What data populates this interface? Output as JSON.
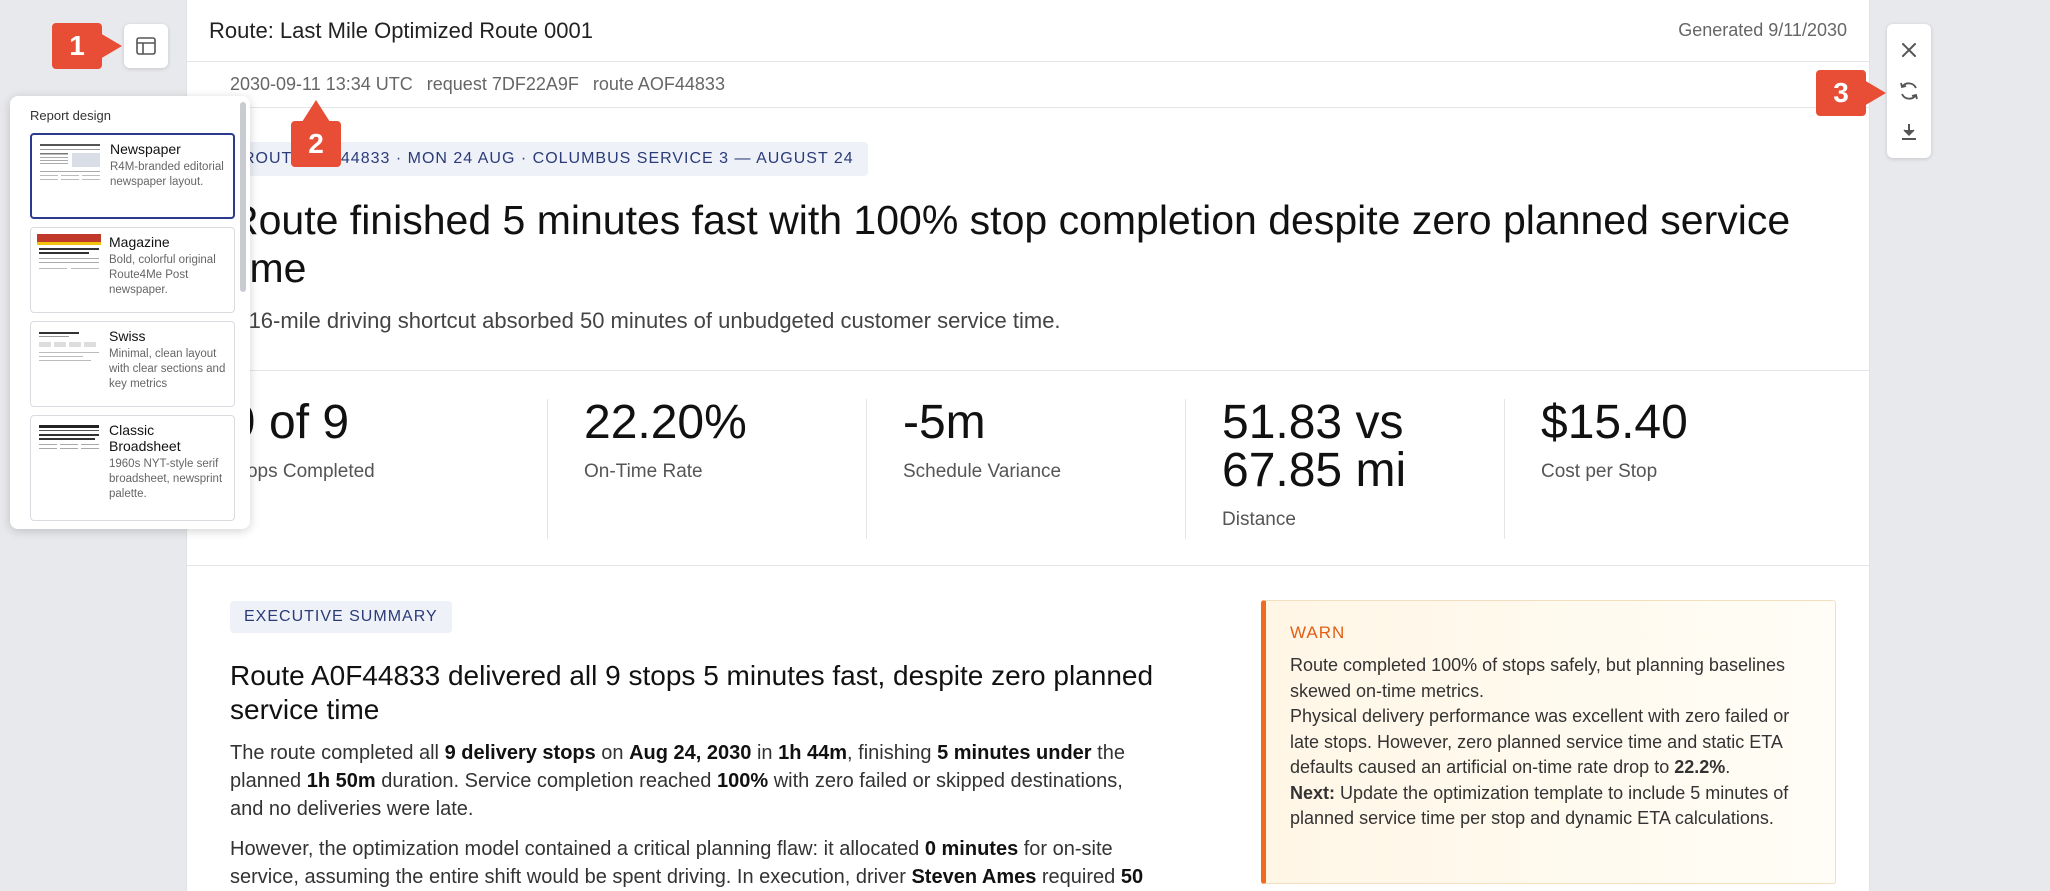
{
  "header": {
    "title": "Route: Last Mile Optimized Route 0001",
    "generated": "Generated 9/11/2030"
  },
  "meta": {
    "timestamp": "2030-09-11 13:34 UTC",
    "request": "request 7DF22A9F",
    "route": "route AOF44833"
  },
  "hero": {
    "tag": "ROUTE A0F44833 · MON 24 AUG · COLUMBUS SERVICE 3 — AUGUST 24",
    "headline": "Route finished 5 minutes fast with 100% stop completion despite zero planned service time",
    "subhead": "A 16-mile driving shortcut absorbed 50 minutes of unbudgeted customer service time."
  },
  "kpis": [
    {
      "value": "9 of 9",
      "label": "Stops Completed"
    },
    {
      "value": "22.20%",
      "label": "On-Time Rate"
    },
    {
      "value": "-5m",
      "label": "Schedule Variance"
    },
    {
      "value": "51.83 vs 67.85 mi",
      "label": "Distance"
    },
    {
      "value": "$15.40",
      "label": "Cost per Stop"
    }
  ],
  "summary": {
    "tag": "EXECUTIVE SUMMARY",
    "title": "Route A0F44833 delivered all 9 stops 5 minutes fast, despite zero planned service time",
    "p1": [
      "The route completed all ",
      "9 delivery stops",
      " on ",
      "Aug 24, 2030",
      " in ",
      "1h 44m",
      ", finishing ",
      "5 minutes under",
      " the planned ",
      "1h 50m",
      " duration. Service completion reached ",
      "100%",
      " with zero failed or skipped destinations, and no deliveries were late."
    ],
    "p2": [
      "However, the optimization model contained a critical planning flaw: it allocated ",
      "0 minutes",
      " for on-site service, assuming the entire shift would be spent driving. In execution, driver ",
      "Steven Ames",
      " required ",
      "50"
    ]
  },
  "warn": {
    "label": "WARN",
    "line1": "Route completed 100% of stops safely, but planning baselines skewed on-time metrics.",
    "line2": "Physical delivery performance was excellent with zero failed or late stops. However, zero planned service time and static ETA defaults caused an artificial on-time rate drop to ",
    "line2_bold": "22.2%",
    "line2_end": ".",
    "next_label": "Next:",
    "next_text": " Update the optimization template to include 5 minutes of planned service time per stop and dynamic ETA calculations."
  },
  "panel": {
    "title": "Report design",
    "designs": [
      {
        "name": "Newspaper",
        "desc": "R4M-branded editorial newspaper layout."
      },
      {
        "name": "Magazine",
        "desc": "Bold, colorful original Route4Me Post newspaper."
      },
      {
        "name": "Swiss",
        "desc": "Minimal, clean layout with clear sections and key metrics"
      },
      {
        "name": "Classic Broadsheet",
        "desc": "1960s NYT-style serif broadsheet, newsprint palette."
      }
    ]
  },
  "badges": {
    "b1": "1",
    "b2": "2",
    "b3": "3"
  },
  "colors": {
    "accent": "#2a3b8f",
    "badge": "#e84d36",
    "warn": "#f06a1f"
  }
}
